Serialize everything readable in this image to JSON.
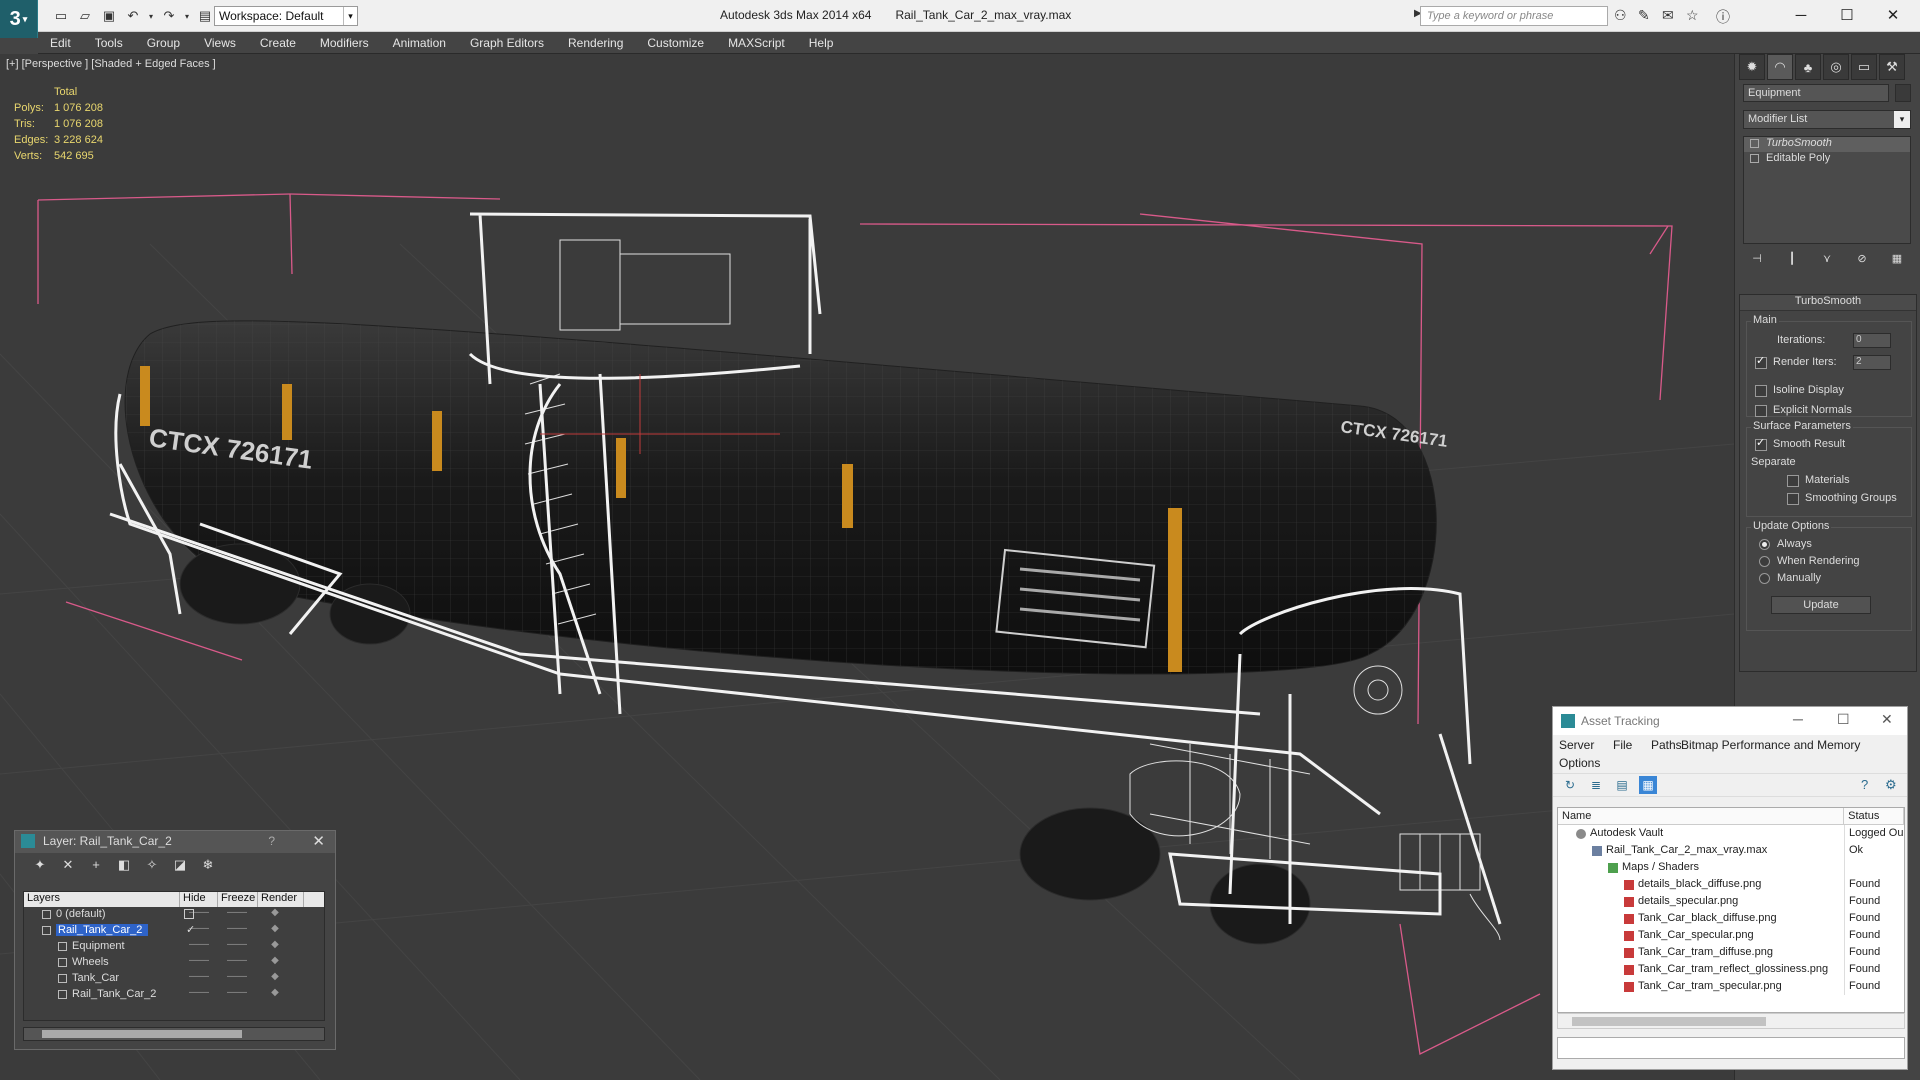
{
  "app": {
    "logo_text": "3",
    "title": "Autodesk 3ds Max  2014 x64",
    "file": "Rail_Tank_Car_2_max_vray.max",
    "workspace": "Workspace: Default",
    "search_placeholder": "Type a keyword or phrase"
  },
  "menu": [
    "Edit",
    "Tools",
    "Group",
    "Views",
    "Create",
    "Modifiers",
    "Animation",
    "Graph Editors",
    "Rendering",
    "Customize",
    "MAXScript",
    "Help"
  ],
  "viewport": {
    "label": "[+] [Perspective ] [Shaded + Edged Faces ]",
    "stats_header": "Total",
    "stats": [
      {
        "key": "Polys:",
        "value": "1 076 208"
      },
      {
        "key": "Tris:",
        "value": "1 076 208"
      },
      {
        "key": "Edges:",
        "value": "3 228 624"
      },
      {
        "key": "Verts:",
        "value": "542 695"
      }
    ],
    "tank_markings": {
      "left_id": "CTCX 726171",
      "right_id": "CTCX 726171"
    }
  },
  "command_panel": {
    "object_name": "Equipment",
    "modifier_list": "Modifier List",
    "stack": [
      {
        "label": "TurboSmooth",
        "selected": true
      },
      {
        "label": "Editable Poly",
        "selected": false
      }
    ],
    "rollout_title": "TurboSmooth",
    "main_group": "Main",
    "iterations_label": "Iterations:",
    "iterations_value": "0",
    "render_iters_label": "Render Iters:",
    "render_iters_value": "2",
    "isoline": "Isoline Display",
    "explicit_normals": "Explicit Normals",
    "surface_group": "Surface Parameters",
    "smooth_result": "Smooth Result",
    "separate": "Separate",
    "materials": "Materials",
    "smoothing_groups": "Smoothing Groups",
    "update_group": "Update Options",
    "always": "Always",
    "when_rendering": "When Rendering",
    "manually": "Manually",
    "update_button": "Update"
  },
  "layer_window": {
    "title": "Layer: Rail_Tank_Car_2",
    "help": "?",
    "columns": [
      "Layers",
      "Hide",
      "Freeze",
      "Render"
    ],
    "rows": [
      {
        "name": "0 (default)",
        "indent": 0
      },
      {
        "name": "Rail_Tank_Car_2",
        "indent": 0,
        "selected": true
      },
      {
        "name": "Equipment",
        "indent": 1
      },
      {
        "name": "Wheels",
        "indent": 1
      },
      {
        "name": "Tank_Car",
        "indent": 1
      },
      {
        "name": "Rail_Tank_Car_2",
        "indent": 1
      }
    ]
  },
  "asset_tracking": {
    "title": "Asset Tracking",
    "menu": [
      "Server",
      "File",
      "Paths",
      "Bitmap Performance and Memory",
      "Options"
    ],
    "columns": [
      "Name",
      "Status"
    ],
    "rows": [
      {
        "name": "Autodesk Vault",
        "status": "Logged Ou",
        "indent": 0
      },
      {
        "name": "Rail_Tank_Car_2_max_vray.max",
        "status": "Ok",
        "indent": 1
      },
      {
        "name": "Maps / Shaders",
        "status": "",
        "indent": 2
      },
      {
        "name": "details_black_diffuse.png",
        "status": "Found",
        "indent": 3
      },
      {
        "name": "details_specular.png",
        "status": "Found",
        "indent": 3
      },
      {
        "name": "Tank_Car_black_diffuse.png",
        "status": "Found",
        "indent": 3
      },
      {
        "name": "Tank_Car_specular.png",
        "status": "Found",
        "indent": 3
      },
      {
        "name": "Tank_Car_tram_diffuse.png",
        "status": "Found",
        "indent": 3
      },
      {
        "name": "Tank_Car_tram_reflect_glossiness.png",
        "status": "Found",
        "indent": 3
      },
      {
        "name": "Tank_Car_tram_specular.png",
        "status": "Found",
        "indent": 3
      }
    ]
  }
}
